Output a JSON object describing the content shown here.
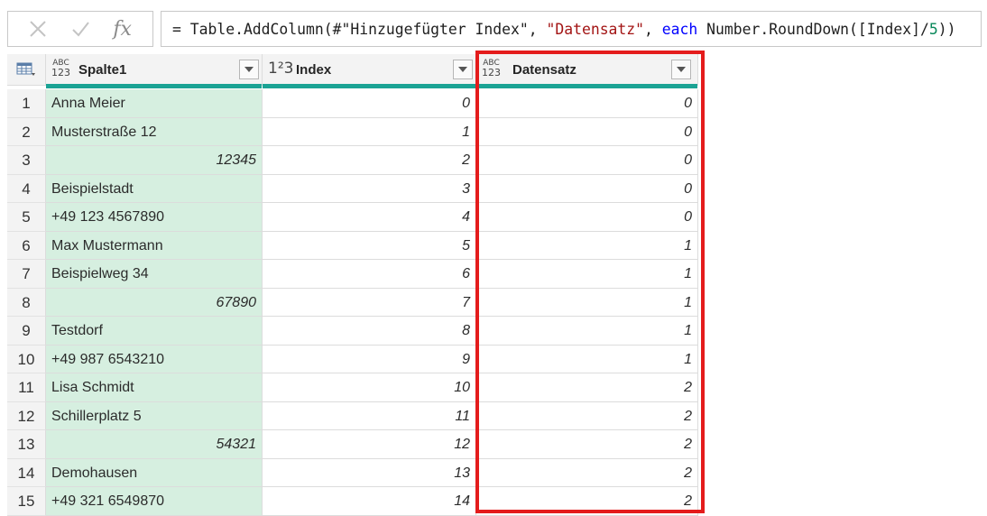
{
  "formula_bar": {
    "cancel_icon": "x-icon",
    "confirm_icon": "check-icon",
    "fx_label": "fx",
    "formula_prefix": "= Table.AddColumn(#",
    "formula_str1": "\"Hinzugefügter Index\"",
    "formula_sep1": ", ",
    "formula_str2": "\"Datensatz\"",
    "formula_sep2": ", ",
    "formula_kw": "each",
    "formula_mid": " Number.RoundDown([Index]/",
    "formula_num": "5",
    "formula_end": "))"
  },
  "columns": [
    {
      "name": "Spalte1",
      "type": "any",
      "type_top": "ABC",
      "type_bottom": "123"
    },
    {
      "name": "Index",
      "type": "integer",
      "type_label": "1²3"
    },
    {
      "name": "Datensatz",
      "type": "any",
      "type_top": "ABC",
      "type_bottom": "123"
    }
  ],
  "rows": [
    {
      "n": "1",
      "spalte1": "Anna Meier",
      "spalte1_numeric": false,
      "index": "0",
      "datensatz": "0"
    },
    {
      "n": "2",
      "spalte1": "Musterstraße 12",
      "spalte1_numeric": false,
      "index": "1",
      "datensatz": "0"
    },
    {
      "n": "3",
      "spalte1": "12345",
      "spalte1_numeric": true,
      "index": "2",
      "datensatz": "0"
    },
    {
      "n": "4",
      "spalte1": "Beispielstadt",
      "spalte1_numeric": false,
      "index": "3",
      "datensatz": "0"
    },
    {
      "n": "5",
      "spalte1": "+49 123 4567890",
      "spalte1_numeric": false,
      "index": "4",
      "datensatz": "0"
    },
    {
      "n": "6",
      "spalte1": "Max Mustermann",
      "spalte1_numeric": false,
      "index": "5",
      "datensatz": "1"
    },
    {
      "n": "7",
      "spalte1": "Beispielweg 34",
      "spalte1_numeric": false,
      "index": "6",
      "datensatz": "1"
    },
    {
      "n": "8",
      "spalte1": "67890",
      "spalte1_numeric": true,
      "index": "7",
      "datensatz": "1"
    },
    {
      "n": "9",
      "spalte1": "Testdorf",
      "spalte1_numeric": false,
      "index": "8",
      "datensatz": "1"
    },
    {
      "n": "10",
      "spalte1": "+49 987 6543210",
      "spalte1_numeric": false,
      "index": "9",
      "datensatz": "1"
    },
    {
      "n": "11",
      "spalte1": "Lisa Schmidt",
      "spalte1_numeric": false,
      "index": "10",
      "datensatz": "2"
    },
    {
      "n": "12",
      "spalte1": "Schillerplatz 5",
      "spalte1_numeric": false,
      "index": "11",
      "datensatz": "2"
    },
    {
      "n": "13",
      "spalte1": "54321",
      "spalte1_numeric": true,
      "index": "12",
      "datensatz": "2"
    },
    {
      "n": "14",
      "spalte1": "Demohausen",
      "spalte1_numeric": false,
      "index": "13",
      "datensatz": "2"
    },
    {
      "n": "15",
      "spalte1": "+49 321 6549870",
      "spalte1_numeric": false,
      "index": "14",
      "datensatz": "2"
    }
  ],
  "colors": {
    "selected_column_bg": "#d6efe0",
    "column_quality_bar": "#1aa394",
    "highlight_border": "#e41c1c"
  }
}
